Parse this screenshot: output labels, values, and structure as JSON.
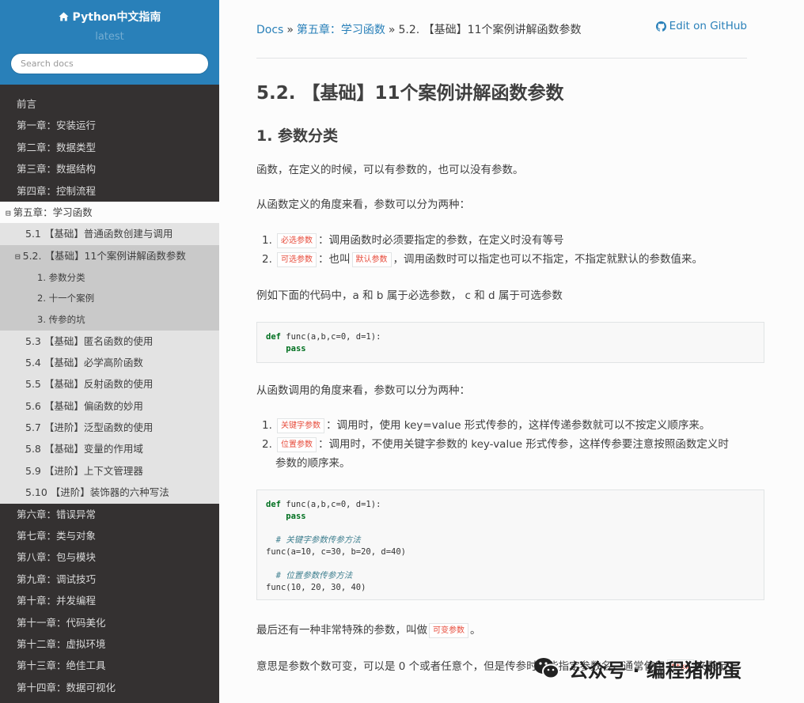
{
  "sidebar": {
    "project_title": "Python中文指南",
    "version": "latest",
    "search_placeholder": "Search docs",
    "chapters_top": [
      "前言",
      "第一章：安装运行",
      "第二章：数据类型",
      "第三章：数据结构",
      "第四章：控制流程"
    ],
    "current_chapter": "第五章：学习函数",
    "section_before": "5.1 【基础】普通函数创建与调用",
    "current_section": "5.2. 【基础】11个案例讲解函数参数",
    "subsections": [
      "1. 参数分类",
      "2. 十一个案例",
      "3. 传参的坑"
    ],
    "sections_after": [
      "5.3 【基础】匿名函数的使用",
      "5.4 【基础】必学高阶函数",
      "5.5 【基础】反射函数的使用",
      "5.6 【基础】偏函数的妙用",
      "5.7 【进阶】泛型函数的使用",
      "5.8 【基础】变量的作用域",
      "5.9 【进阶】上下文管理器",
      "5.10 【进阶】装饰器的六种写法"
    ],
    "chapters_bottom": [
      "第六章：错误异常",
      "第七章：类与对象",
      "第八章：包与模块",
      "第九章：调试技巧",
      "第十章：并发编程",
      "第十一章：代码美化",
      "第十二章：虚拟环境",
      "第十三章：绝佳工具",
      "第十四章：数据可视化"
    ],
    "toggle_symbol": "⊟"
  },
  "breadcrumb": {
    "docs": "Docs",
    "sep": "»",
    "chapter": "第五章：学习函数",
    "current": "5.2. 【基础】11个案例讲解函数参数",
    "edit_link": "Edit on GitHub"
  },
  "article": {
    "title": "5.2. 【基础】11个案例讲解函数参数",
    "heading": "1. 参数分类",
    "p1": "函数，在定义的时候，可以有参数的，也可以没有参数。",
    "p2": "从函数定义的角度来看，参数可以分为两种：",
    "list1": {
      "item1": {
        "num": "1.",
        "code": "必选参数",
        "text": "：调用函数时必须要指定的参数，在定义时没有等号"
      },
      "item2": {
        "num": "2.",
        "code": "可选参数",
        "mid": "：也叫",
        "code2": "默认参数",
        "text": "，调用函数时可以指定也可以不指定，不指定就默认的参数值来。"
      }
    },
    "p3": "例如下面的代码中，a 和 b 属于必选参数， c 和 d 属于可选参数",
    "code1": {
      "kw1": "def",
      "line1": " func(a,b,c=0, d=1):",
      "kw2": "pass"
    },
    "p4": "从函数调用的角度来看，参数可以分为两种：",
    "list2": {
      "item1": {
        "num": "1.",
        "code": "关键字参数",
        "text": "：调用时，使用 key=value 形式传参的，这样传递参数就可以不按定义顺序来。"
      },
      "item2": {
        "num": "2.",
        "code": "位置参数",
        "text": "：调用时，不使用关键字参数的 key-value 形式传参，这样传参要注意按照函数定义时",
        "cont": "参数的顺序来。"
      }
    },
    "code2": {
      "kw1": "def",
      "line1": " func(a,b,c=0, d=1):",
      "kw2": "pass",
      "comment1": "# 关键字参数传参方法",
      "line3": "func(a=10, c=30, b=20, d=40)",
      "comment2": "# 位置参数传参方法",
      "line4": "func(10, 20, 30, 40)"
    },
    "p5": {
      "text": "最后还有一种非常特殊的参数，叫做",
      "code": "可变参数",
      "end": "。"
    },
    "p6": {
      "text": "意思是参数个数可变，可以是 0 个或者任意个，但是传参时不能指定参数名，通常使用",
      "code": "**kw",
      "end": "来表示："
    }
  },
  "watermark": {
    "text": "公众号 · 编程猪柳蛋"
  }
}
